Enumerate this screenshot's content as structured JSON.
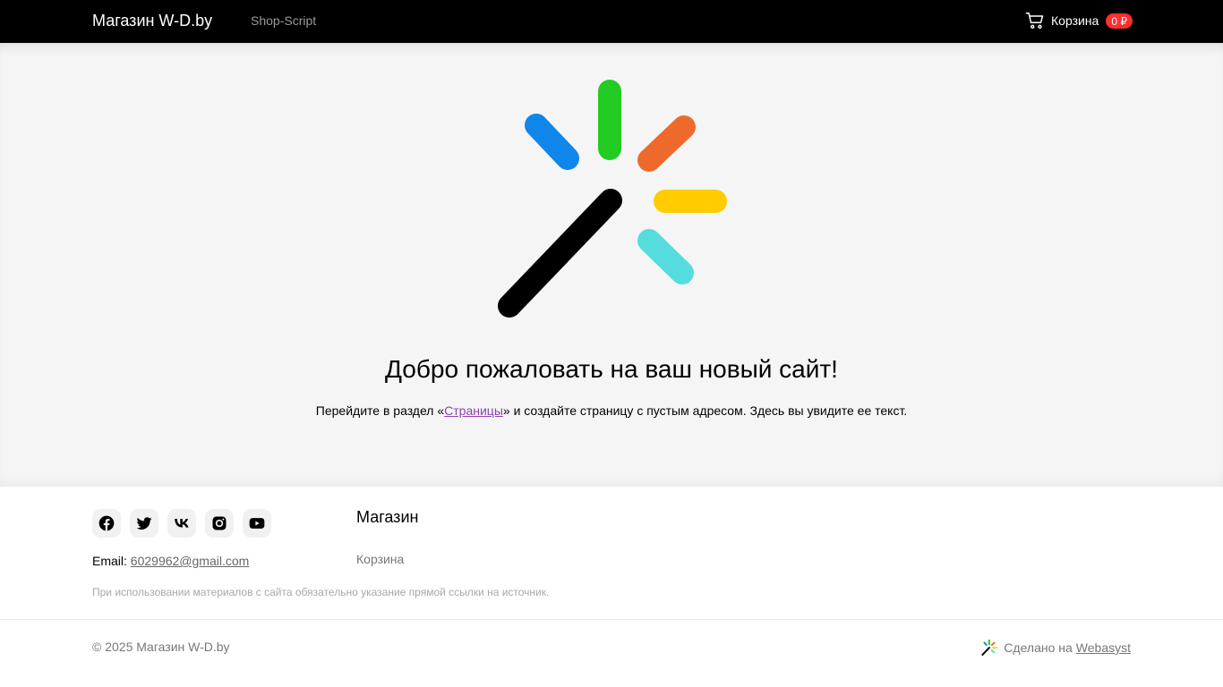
{
  "header": {
    "brand": "Магазин W-D.by",
    "nav_link": "Shop-Script",
    "cart_label": "Корзина",
    "cart_badge": "0 ₽"
  },
  "hero": {
    "logo_icon": "webasyst-logo-icon",
    "title": "Добро пожаловать на ваш новый сайт!",
    "text_before": "Перейдите в раздел «",
    "link": "Страницы",
    "text_after": "» и создайте страницу с пустым адресом. Здесь вы увидите ее текст."
  },
  "footer": {
    "social": [
      "facebook-icon",
      "twitter-icon",
      "vk-icon",
      "instagram-icon",
      "youtube-icon"
    ],
    "email_label": "Email:",
    "email": "6029962@gmail.com",
    "menu_heading": "Магазин",
    "menu_link": "Корзина",
    "disclaimer": "При использовании материалов с сайта обязательно указание прямой ссылки на источник.",
    "copyright": "© 2025 Магазин W-D.by",
    "made_text": "Сделано на",
    "made_link": "Webasyst"
  },
  "colors": {
    "header_bg": "#000000",
    "hero_bg": "#f5f5f5",
    "badge": "#ff2e2e",
    "link": "#8e44ad",
    "logo_green": "#22cc22",
    "logo_blue": "#0f86ea",
    "logo_orange": "#ee6a2c",
    "logo_yellow": "#ffcc00",
    "logo_cyan": "#55dddd",
    "logo_black": "#000000"
  }
}
